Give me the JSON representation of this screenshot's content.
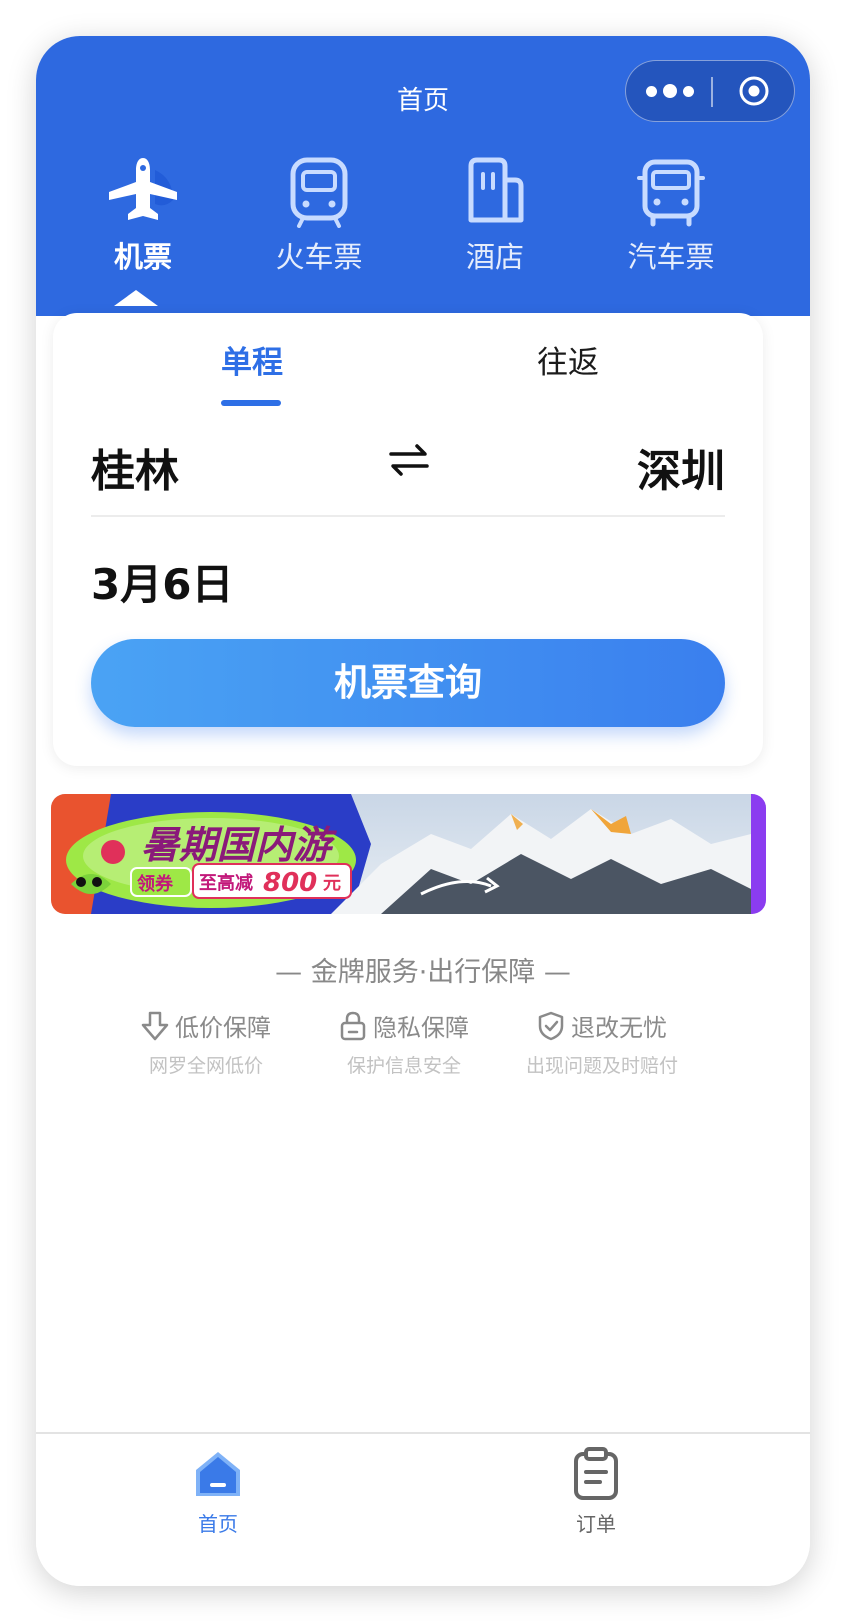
{
  "header": {
    "title": "首页",
    "categories": [
      {
        "label": "机票",
        "icon": "airplane-icon",
        "active": true
      },
      {
        "label": "火车票",
        "icon": "train-icon",
        "active": false
      },
      {
        "label": "酒店",
        "icon": "hotel-icon",
        "active": false
      },
      {
        "label": "汽车票",
        "icon": "bus-icon",
        "active": false
      }
    ]
  },
  "capsule": {
    "more_icon": "more-dots-icon",
    "close_icon": "target-icon"
  },
  "search": {
    "tabs": [
      {
        "label": "单程",
        "active": true
      },
      {
        "label": "往返",
        "active": false
      }
    ],
    "from_city": "桂林",
    "to_city": "深圳",
    "swap_icon": "swap-arrows-icon",
    "date": "3月6日",
    "button_label": "机票查询"
  },
  "banner": {
    "headline": "暑期国内游",
    "coupon_tag": "领券",
    "discount_text": "至高减",
    "discount_amount": "800",
    "discount_unit": "元"
  },
  "guarantee": {
    "title": "— 金牌服务·出行保障 —",
    "items": [
      {
        "name": "低价保障",
        "desc": "网罗全网低价",
        "icon": "down-arrow-icon"
      },
      {
        "name": "隐私保障",
        "desc": "保护信息安全",
        "icon": "lock-icon"
      },
      {
        "name": "退改无忧",
        "desc": "出现问题及时赔付",
        "icon": "shield-check-icon"
      }
    ]
  },
  "tabbar": {
    "items": [
      {
        "label": "首页",
        "icon": "home-icon",
        "active": true
      },
      {
        "label": "订单",
        "icon": "clipboard-icon",
        "active": false
      }
    ]
  },
  "colors": {
    "brand": "#2e69e0",
    "accent": "#2e6fe6",
    "button_start": "#4aa3f4",
    "button_end": "#3a7fee"
  }
}
